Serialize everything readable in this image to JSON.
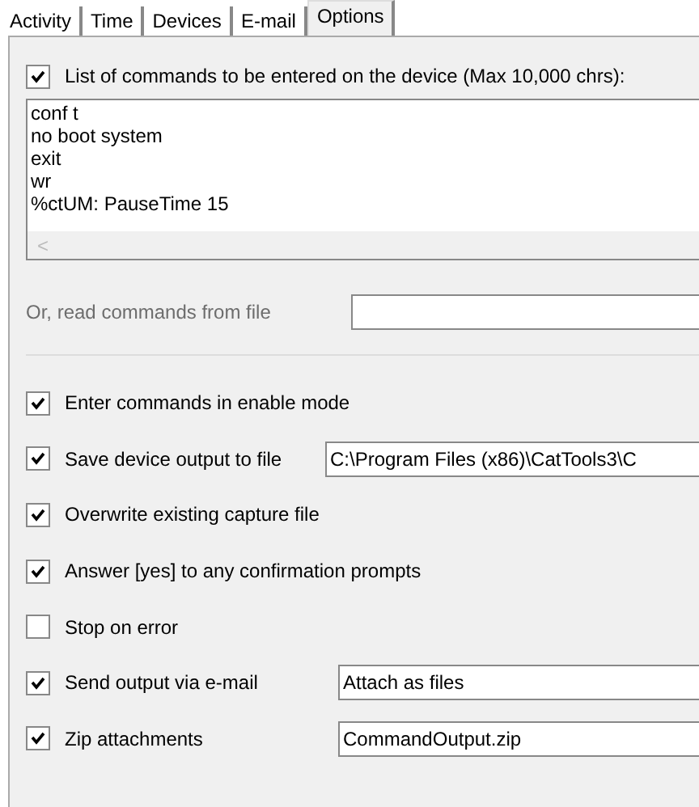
{
  "tabs": [
    {
      "label": "Activity",
      "selected": false
    },
    {
      "label": "Time",
      "selected": false
    },
    {
      "label": "Devices",
      "selected": false
    },
    {
      "label": "E-mail",
      "selected": false
    },
    {
      "label": "Options",
      "selected": true
    }
  ],
  "commands": {
    "label": "List of commands to be entered on the device (Max 10,000 chrs):",
    "checked": true,
    "lines": [
      "conf t",
      "no boot system",
      "exit",
      "wr",
      "%ctUM: PauseTime 15"
    ],
    "scroll_arrow": "<"
  },
  "read_from_file": {
    "label": "Or, read commands from file",
    "disabled": true
  },
  "options": [
    {
      "label": "Enter commands in enable mode",
      "checked": true
    },
    {
      "label": "Save device output to file",
      "checked": true,
      "value": "C:\\Program Files (x86)\\CatTools3\\C"
    },
    {
      "label": "Overwrite existing capture file",
      "checked": true
    },
    {
      "label": "Answer [yes] to any confirmation prompts",
      "checked": true
    },
    {
      "label": "Stop on error",
      "checked": false
    },
    {
      "label": "Send output via e-mail",
      "checked": true,
      "value": "Attach as files"
    },
    {
      "label": "Zip attachments",
      "checked": true,
      "value": "CommandOutput.zip"
    }
  ]
}
